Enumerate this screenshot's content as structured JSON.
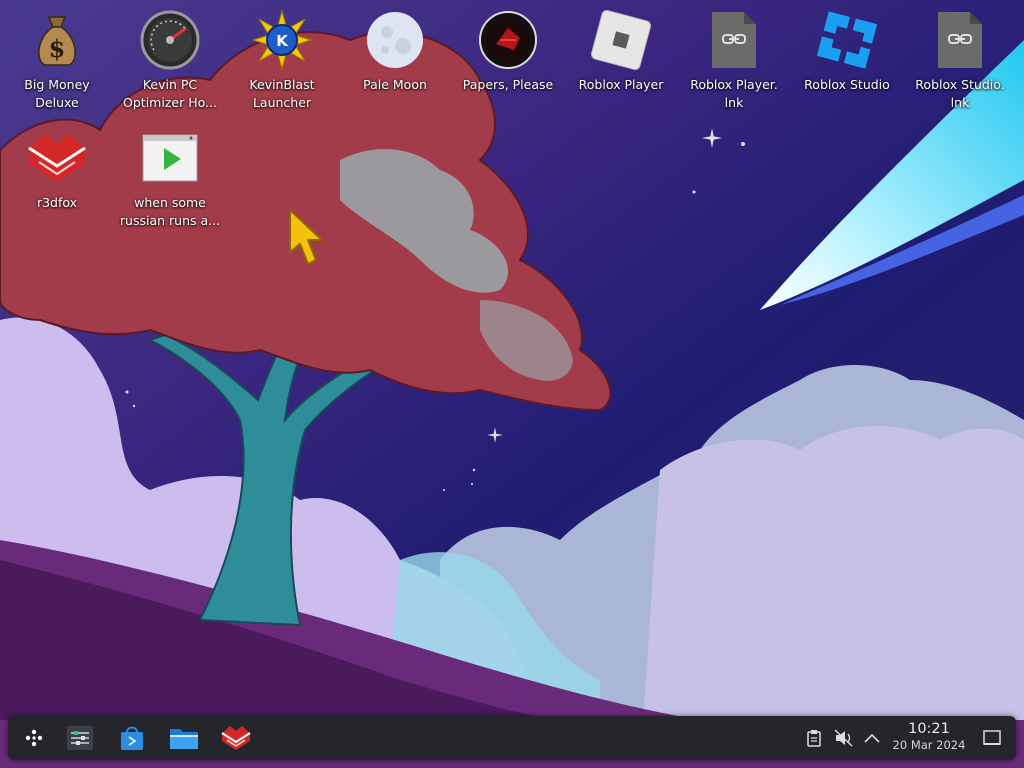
{
  "desktop": {
    "icons": [
      {
        "label": "Big Money\nDeluxe",
        "icon": "money-bag-icon"
      },
      {
        "label": "Kevin PC\nOptimizer Ho...",
        "icon": "speedometer-icon"
      },
      {
        "label": "KevinBlast\nLauncher",
        "icon": "kevinblast-icon"
      },
      {
        "label": "Pale Moon",
        "icon": "pale-moon-icon"
      },
      {
        "label": "Papers, Please",
        "icon": "papers-please-icon"
      },
      {
        "label": "Roblox Player",
        "icon": "roblox-player-icon"
      },
      {
        "label": "Roblox Player.\nlnk",
        "icon": "shortcut-file-icon"
      },
      {
        "label": "Roblox Studio",
        "icon": "roblox-studio-icon"
      },
      {
        "label": "Roblox Studio.\nlnk",
        "icon": "shortcut-file-icon"
      },
      {
        "label": "r3dfox",
        "icon": "r3dfox-icon"
      },
      {
        "label": "when some\nrussian runs a...",
        "icon": "video-file-icon"
      }
    ]
  },
  "taskbar": {
    "launchers": [
      {
        "name": "application-launcher",
        "icon": "kde-launcher-icon"
      },
      {
        "name": "system-settings",
        "icon": "settings-sliders-icon"
      },
      {
        "name": "discover-store",
        "icon": "store-bag-icon"
      },
      {
        "name": "file-manager",
        "icon": "folder-icon"
      },
      {
        "name": "r3dfox-browser",
        "icon": "r3dfox-icon"
      }
    ],
    "tray": {
      "icons": [
        "clipboard-icon",
        "volume-muted-icon",
        "chevron-up-icon"
      ]
    },
    "clock": {
      "time": "10:21",
      "date": "20 Mar 2024"
    },
    "show_desktop_icon": "show-desktop-icon"
  },
  "colors": {
    "panel_bg": "#24262c",
    "sky_top": "#1d1f6e",
    "sky_purple": "#5a2b8c",
    "tree_red": "#a43a4a",
    "cloud_light": "#c9b6e6",
    "accent_blue": "#3daee9"
  }
}
